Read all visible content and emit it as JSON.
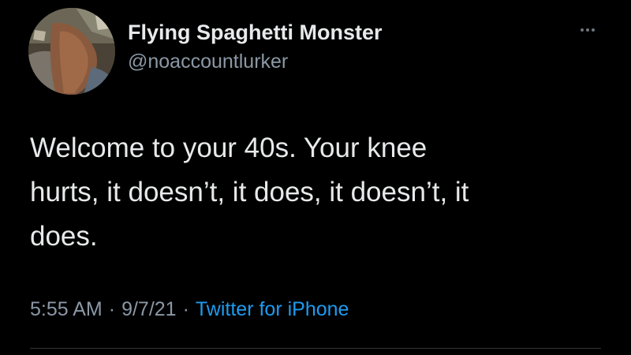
{
  "author": {
    "display_name": "Flying Spaghetti Monster",
    "handle": "@noaccountlurker",
    "avatar": "profile-photo"
  },
  "tweet": {
    "lines": [
      "Welcome to your 40s. Your knee",
      "hurts, it doesn’t, it does, it doesn’t, it",
      "does."
    ],
    "time": "5:55 AM",
    "separator": "·",
    "date": "9/7/21",
    "source": "Twitter for iPhone"
  },
  "icons": {
    "more": "more-options-icon"
  },
  "colors": {
    "background": "#000000",
    "primary_text": "#e7e9ea",
    "secondary_text": "#8b98a5",
    "link": "#1d9bf0"
  }
}
